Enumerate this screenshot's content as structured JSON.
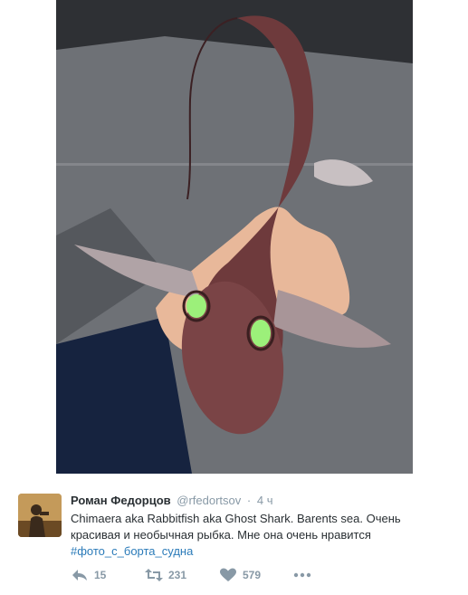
{
  "photo": {
    "subject": "chimaera-fish-in-hand"
  },
  "tweet": {
    "fullname": "Роман Федорцов",
    "handle": "@rfedortsov",
    "separator": "·",
    "time": "4 ч",
    "text_line1": "Chimaera aka Rabbitfish aka Ghost Shark. Barents sea. Очень",
    "text_line2": "красивая и необычная рыбка. Мне она очень нравится",
    "hashtag": "#фото_с_борта_судна",
    "actions": {
      "reply_count": "15",
      "retweet_count": "231",
      "like_count": "579"
    }
  },
  "colors": {
    "name": "#292f33",
    "muted": "#8899a6",
    "link": "#2b7bb9",
    "eye": "#9cf07a"
  }
}
